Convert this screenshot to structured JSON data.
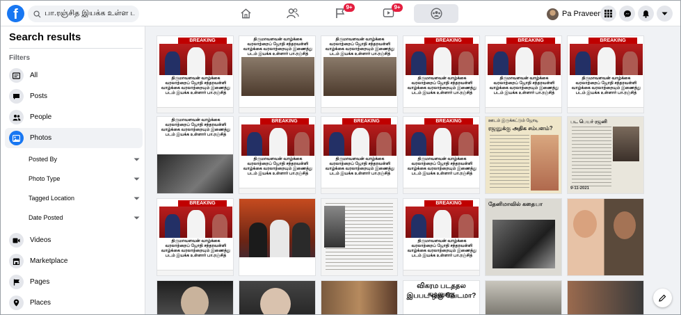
{
  "header": {
    "logo_letter": "f",
    "search_value": "பா.ரஞ்சித இயக்க உள்ள படி",
    "tabs": [
      {
        "name": "home",
        "badge": ""
      },
      {
        "name": "friends",
        "badge": ""
      },
      {
        "name": "pages",
        "badge": "9+"
      },
      {
        "name": "watch",
        "badge": "9+"
      },
      {
        "name": "groups",
        "badge": ""
      }
    ],
    "profile_name": "Pa Praveen",
    "colors": {
      "brand": "#1877f2",
      "badge": "#e41e3f"
    }
  },
  "sidebar": {
    "title": "Search results",
    "filters_label": "Filters",
    "items": [
      {
        "label": "All",
        "icon": "all-icon"
      },
      {
        "label": "Posts",
        "icon": "posts-icon"
      },
      {
        "label": "People",
        "icon": "people-icon"
      },
      {
        "label": "Photos",
        "icon": "photos-icon",
        "active": true
      }
    ],
    "photo_filters": [
      {
        "label": "Posted By"
      },
      {
        "label": "Photo Type"
      },
      {
        "label": "Tagged Location"
      },
      {
        "label": "Date Posted"
      }
    ],
    "more_items": [
      {
        "label": "Videos",
        "icon": "videos-icon"
      },
      {
        "label": "Marketplace",
        "icon": "marketplace-icon"
      },
      {
        "label": "Pages",
        "icon": "pages-icon"
      },
      {
        "label": "Places",
        "icon": "places-icon"
      }
    ]
  },
  "results": {
    "breaking_label": "BREAKING",
    "news_caption": "திருமாவளவன் வாழ்க்கை வரலாற்றைப் ஜோதி சந்தரவள்ளி வாழ்க்கை வரலாற்றையும் இணைத்து படம் இயக்க உள்ளார் பா.ரஞ்சித்",
    "paper_headline_1": "ஊடம் இருக்கட்டும் ஜோடி",
    "paper_headline_2": "ரஜனுக்கு அதிக சம்பளம்?",
    "paper_headline_3": "பட பெயர் ரஜனி",
    "paper_headline_4": "தேனிமாவில் கதையா",
    "banner_text_1": "விகரம படததல கமலுககு",
    "banner_text_2": "இபபட ஒரு வேடமா?",
    "date_text": "9-11-2021"
  }
}
